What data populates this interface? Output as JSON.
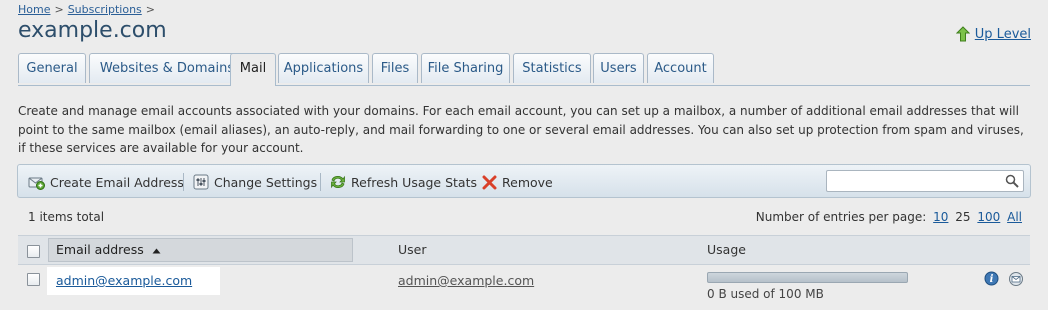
{
  "breadcrumb": {
    "home": "Home",
    "separator": ">",
    "subscriptions": "Subscriptions"
  },
  "page": {
    "title": "example.com",
    "up_level": "Up Level"
  },
  "tabs": [
    {
      "label": "General"
    },
    {
      "label": "Websites & Domains"
    },
    {
      "label": "Mail",
      "active": true
    },
    {
      "label": "Applications"
    },
    {
      "label": "Files"
    },
    {
      "label": "File Sharing"
    },
    {
      "label": "Statistics"
    },
    {
      "label": "Users"
    },
    {
      "label": "Account"
    }
  ],
  "description": "Create and manage email accounts associated with your domains. For each email account, you can set up a mailbox, a number of additional email addresses that will point to the same mailbox (email aliases), an auto-reply, and mail forwarding to one or several email addresses. You can also set up protection from spam and viruses, if these services are available for your account.",
  "toolbar": {
    "create_email": "Create Email Address",
    "change_settings": "Change Settings",
    "refresh_usage": "Refresh Usage Stats",
    "remove": "Remove",
    "search_value": "",
    "search_placeholder": ""
  },
  "list": {
    "items_total": "1 items total",
    "per_page_label": "Number of entries per page:",
    "per_page_options": [
      "10",
      "25",
      "100",
      "All"
    ],
    "per_page_selected": "25"
  },
  "grid": {
    "columns": {
      "email": "Email address",
      "user": "User",
      "usage": "Usage"
    },
    "rows": [
      {
        "email": "admin@example.com",
        "user": "admin@example.com",
        "usage_text": "0 B used of 100 MB",
        "usage_fraction": 0
      }
    ]
  },
  "colors": {
    "link": "#1a5a9a",
    "title": "#2d4e6b",
    "background": "#ececec",
    "remove_icon": "#d9402a",
    "refresh_icon": "#4a9a2a"
  },
  "icons": [
    "up-level-icon",
    "create-email-icon",
    "change-settings-icon",
    "refresh-icon",
    "remove-icon",
    "search-icon",
    "sort-asc-icon",
    "info-icon",
    "mail-settings-icon"
  ]
}
